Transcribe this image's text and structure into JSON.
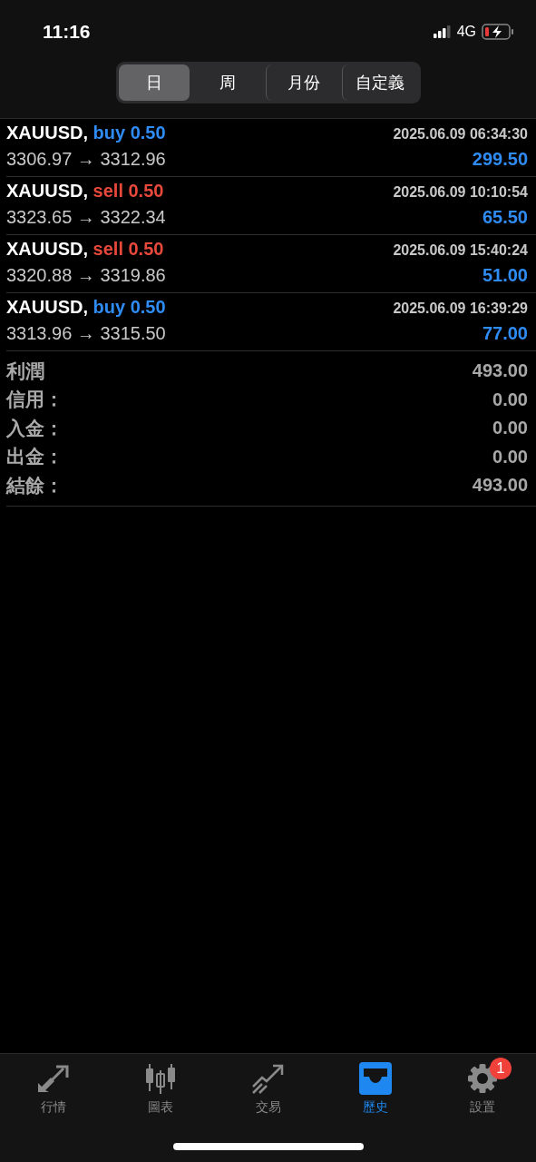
{
  "status_bar": {
    "time": "11:16",
    "network": "4G"
  },
  "period_tabs": [
    {
      "label": "日",
      "selected": true
    },
    {
      "label": "周",
      "selected": false
    },
    {
      "label": "月份",
      "selected": false
    },
    {
      "label": "自定義",
      "selected": false
    }
  ],
  "trades": [
    {
      "symbol": "XAUUSD,",
      "side": "buy",
      "kind": "buy",
      "volume": "0.50",
      "time": "2025.06.09 06:34:30",
      "open": "3306.97",
      "arrow": "→",
      "close": "3312.96",
      "profit": "299.50"
    },
    {
      "symbol": "XAUUSD,",
      "side": "sell",
      "kind": "sell",
      "volume": "0.50",
      "time": "2025.06.09 10:10:54",
      "open": "3323.65",
      "arrow": "→",
      "close": "3322.34",
      "profit": "65.50"
    },
    {
      "symbol": "XAUUSD,",
      "side": "sell",
      "kind": "sell",
      "volume": "0.50",
      "time": "2025.06.09 15:40:24",
      "open": "3320.88",
      "arrow": "→",
      "close": "3319.86",
      "profit": "51.00"
    },
    {
      "symbol": "XAUUSD,",
      "side": "buy",
      "kind": "buy",
      "volume": "0.50",
      "time": "2025.06.09 16:39:29",
      "open": "3313.96",
      "arrow": "→",
      "close": "3315.50",
      "profit": "77.00"
    }
  ],
  "summary": [
    {
      "label": "利潤",
      "value": "493.00"
    },
    {
      "label": "信用：",
      "value": "0.00"
    },
    {
      "label": "入金：",
      "value": "0.00"
    },
    {
      "label": "出金：",
      "value": "0.00"
    },
    {
      "label": "結餘：",
      "value": "493.00"
    }
  ],
  "tab_bar": [
    {
      "label": "行情",
      "kind": "quotes",
      "selected": false
    },
    {
      "label": "圖表",
      "kind": "chart",
      "selected": false
    },
    {
      "label": "交易",
      "kind": "trade",
      "selected": false
    },
    {
      "label": "歷史",
      "kind": "history",
      "selected": true
    },
    {
      "label": "設置",
      "kind": "settings",
      "selected": false,
      "badge": "1"
    }
  ]
}
